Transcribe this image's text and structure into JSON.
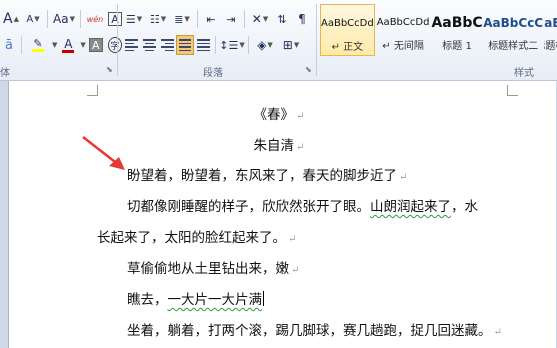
{
  "ribbon": {
    "font": {
      "grow_a": "A",
      "shrink_a": "A",
      "change_case": "Aa",
      "clear_format": "wén",
      "char_border": "A",
      "font_color_a": "A",
      "char_shading": "A",
      "enclose_char": "字",
      "font_color": "#c00000",
      "highlight_color": "#ffff00"
    },
    "groups": {
      "font_tail": "体",
      "paragraph": "段落",
      "styles": "样式"
    },
    "styles": [
      {
        "sample": "AaBbCcDd",
        "name": "↵ 正文",
        "active": true
      },
      {
        "sample": "AaBbCcDd",
        "name": "↵ 无间隔",
        "active": false
      },
      {
        "sample": "AaBbC",
        "name": "标题 1",
        "active": false
      },
      {
        "sample": "AaBbCcC",
        "name": "标题样式二",
        "active": false
      },
      {
        "sample": "AaBl",
        "name": "标题样",
        "active": false
      }
    ]
  },
  "document": {
    "title": "《春》",
    "author": "朱自清",
    "para_mark": "↵",
    "lines": {
      "l1": "盼望着，盼望着，东风来了，春天的脚步近了",
      "l2a": "切都像刚睡醒的样子，欣欣然张开了眼。",
      "l2b": "山朗润起来了",
      "l2c": "，水",
      "l3": "长起来了，太阳的脸红起来了。",
      "l4": "草偷偷地从土里钻出来，嫩",
      "l5a": "瞧去，",
      "l5b": "一大片一大片满",
      "l6": "坐着，躺着，打两个滚，踢几脚球，赛几趟跑，捉几回迷藏。"
    }
  }
}
